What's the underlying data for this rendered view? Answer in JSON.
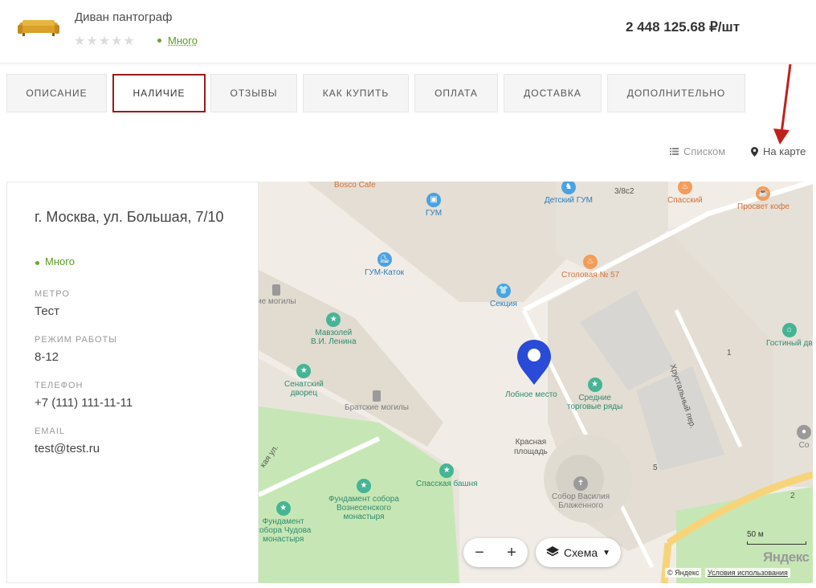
{
  "product": {
    "name": "Диван пантограф",
    "stars": "★★★★★",
    "rating": 0,
    "stock": "Много",
    "price": "2 448 125.68 ₽/шт"
  },
  "tabs": [
    {
      "label": "Описание"
    },
    {
      "label": "Наличие",
      "active": true
    },
    {
      "label": "Отзывы"
    },
    {
      "label": "Как купить"
    },
    {
      "label": "Оплата"
    },
    {
      "label": "Доставка"
    },
    {
      "label": "Дополнительно"
    }
  ],
  "view_toggle": {
    "list_label": "Списком",
    "map_label": "На карте",
    "list_icon": "list-icon",
    "map_icon": "map-pin-icon",
    "active": "map"
  },
  "store": {
    "address": "г. Москва, ул. Большая, 7/10",
    "stock": "Много",
    "metro_label": "МЕТРО",
    "metro": "Тест",
    "hours_label": "РЕЖИМ РАБОТЫ",
    "hours": "8-12",
    "phone_label": "ТЕЛЕФОН",
    "phone": "+7 (111) 111-11-11",
    "email_label": "EMAIL",
    "email": "test@test.ru"
  },
  "map": {
    "pois": {
      "bosco": "Bosco Cafe",
      "gum": "ГУМ",
      "detsky_gum": "Детский ГУМ",
      "house_38c2": "3/8с2",
      "spassky": "Спасский",
      "prosvet": "Просвет кофе",
      "gum_katok": "ГУМ-Каток",
      "stolovaya": "Столовая № 57",
      "mogily_left": "ие могилы",
      "sektsia": "Секция",
      "mavzoley_1": "Мавзолей",
      "mavzoley_2": "В.И. Ленина",
      "hrustalny": "Хрустальный пер.",
      "gostiny": "Гостиный дв",
      "senatsky_1": "Сенатский",
      "senatsky_2": "дворец",
      "lobnoe": "Лобное место",
      "srednie_1": "Средние",
      "srednie_2": "торговые ряды",
      "bratskie": "Братские могилы",
      "krasnaya_1": "Красная",
      "krasnaya_2": "площадь",
      "house_1": "1",
      "house_5": "5",
      "house_2": "2",
      "so_partial": "Со",
      "street_ul": "кая ул.",
      "spasskaya": "Спасская башня",
      "fundament_vozn_1": "Фундамент собора",
      "fundament_vozn_2": "Вознесенского",
      "fundament_vozn_3": "монастыря",
      "fundament_chud_1": "Фундамент",
      "fundament_chud_2": "собора Чудова",
      "fundament_chud_3": "монастыря",
      "vasily_1": "Собор Василия",
      "vasily_2": "Блаженного"
    },
    "layers_label": "Схема",
    "scale_label": "50 м",
    "logo": "Яндекс",
    "copyright": "© Яндекс",
    "terms": "Условия использования",
    "colors": {
      "green_poi": "#46b495",
      "blue_poi": "#4aa2e2",
      "orange_poi": "#f29d5a",
      "marker": "#2a4bd7",
      "park": "#c6e7b5",
      "road": "#f7d47c"
    }
  },
  "colors": {
    "accent": "#9e1a1a",
    "stock_green": "#5b9a24"
  }
}
